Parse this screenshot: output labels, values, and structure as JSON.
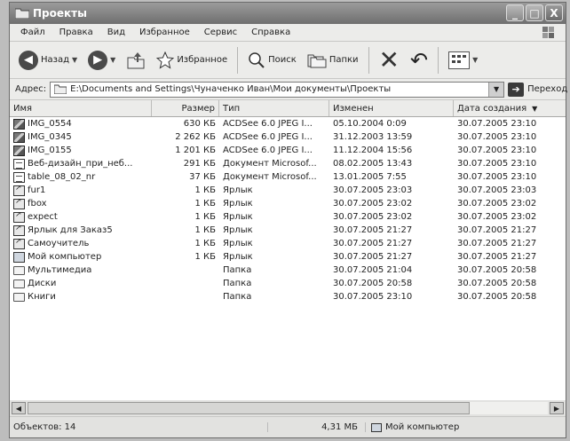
{
  "window": {
    "title": "Проекты"
  },
  "title_buttons": [
    "_",
    "□",
    "X"
  ],
  "menu": [
    "Файл",
    "Правка",
    "Вид",
    "Избранное",
    "Сервис",
    "Справка"
  ],
  "toolbar": {
    "back_label": "Назад",
    "favorites_label": "Избранное",
    "search_label": "Поиск",
    "folders_label": "Папки"
  },
  "address": {
    "label": "Адрес:",
    "path": "E:\\Documents and Settings\\Чуначенко Иван\\Мои документы\\Проекты",
    "go_label": "Переход"
  },
  "columns": [
    "Имя",
    "Размер",
    "Тип",
    "Изменен",
    "Дата создания"
  ],
  "files": [
    {
      "name": "IMG_0554",
      "size": "630 КБ",
      "type": "ACDSee 6.0 JPEG I...",
      "modified": "05.10.2004 0:09",
      "created": "30.07.2005 23:10",
      "icon": "image-icon"
    },
    {
      "name": "IMG_0345",
      "size": "2 262 КБ",
      "type": "ACDSee 6.0 JPEG I...",
      "modified": "31.12.2003 13:59",
      "created": "30.07.2005 23:10",
      "icon": "image-icon"
    },
    {
      "name": "IMG_0155",
      "size": "1 201 КБ",
      "type": "ACDSee 6.0 JPEG I...",
      "modified": "11.12.2004 15:56",
      "created": "30.07.2005 23:10",
      "icon": "image-icon"
    },
    {
      "name": "Веб-дизайн_при_неб...",
      "size": "291 КБ",
      "type": "Документ Microsof...",
      "modified": "08.02.2005 13:43",
      "created": "30.07.2005 23:10",
      "icon": "document-icon"
    },
    {
      "name": "table_08_02_nr",
      "size": "37 КБ",
      "type": "Документ Microsof...",
      "modified": "13.01.2005 7:55",
      "created": "30.07.2005 23:10",
      "icon": "document-icon"
    },
    {
      "name": "fur1",
      "size": "1 КБ",
      "type": "Ярлык",
      "modified": "30.07.2005 23:03",
      "created": "30.07.2005 23:03",
      "icon": "shortcut-icon"
    },
    {
      "name": "fbox",
      "size": "1 КБ",
      "type": "Ярлык",
      "modified": "30.07.2005 23:02",
      "created": "30.07.2005 23:02",
      "icon": "shortcut-icon"
    },
    {
      "name": "expect",
      "size": "1 КБ",
      "type": "Ярлык",
      "modified": "30.07.2005 23:02",
      "created": "30.07.2005 23:02",
      "icon": "shortcut-icon"
    },
    {
      "name": "Ярлык для Заказ5",
      "size": "1 КБ",
      "type": "Ярлык",
      "modified": "30.07.2005 21:27",
      "created": "30.07.2005 21:27",
      "icon": "shortcut-icon"
    },
    {
      "name": "Самоучитель",
      "size": "1 КБ",
      "type": "Ярлык",
      "modified": "30.07.2005 21:27",
      "created": "30.07.2005 21:27",
      "icon": "shortcut-icon"
    },
    {
      "name": "Мой компьютер",
      "size": "1 КБ",
      "type": "Ярлык",
      "modified": "30.07.2005 21:27",
      "created": "30.07.2005 21:27",
      "icon": "computer-icon"
    },
    {
      "name": "Мультимедиа",
      "size": "",
      "type": "Папка",
      "modified": "30.07.2005 21:04",
      "created": "30.07.2005 20:58",
      "icon": "folder-icon"
    },
    {
      "name": "Диски",
      "size": "",
      "type": "Папка",
      "modified": "30.07.2005 20:58",
      "created": "30.07.2005 20:58",
      "icon": "folder-icon"
    },
    {
      "name": "Книги",
      "size": "",
      "type": "Папка",
      "modified": "30.07.2005 23:10",
      "created": "30.07.2005 20:58",
      "icon": "folder-icon"
    }
  ],
  "status": {
    "objects": "Объектов: 14",
    "size": "4,31 МБ",
    "location": "Мой компьютер"
  }
}
